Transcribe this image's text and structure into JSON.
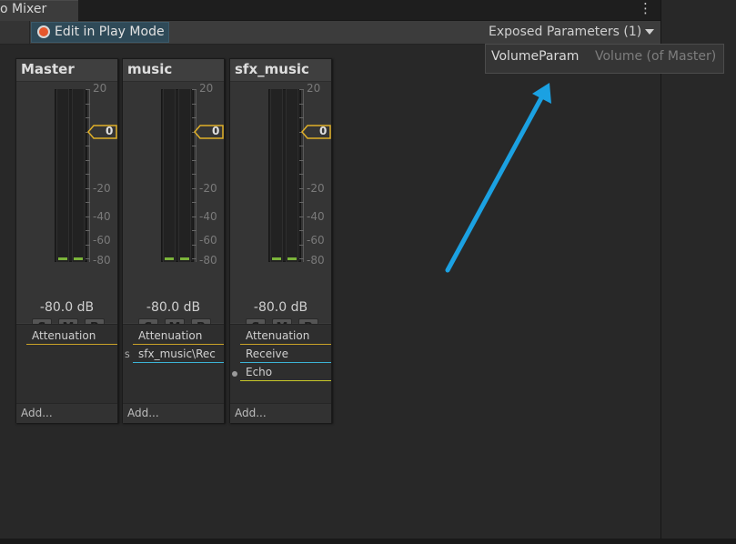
{
  "window": {
    "tab_label": "o Mixer",
    "menu_icon": "kebab-menu-icon"
  },
  "toolbar": {
    "play_mode_label": "Edit in Play Mode",
    "record_icon_color": "#e6572c",
    "exposed_label": "Exposed Parameters (1)"
  },
  "exposed_popup": {
    "param_name": "VolumeParam",
    "param_desc": "Volume (of Master)"
  },
  "annotation": {
    "arrow_color": "#1ba1e2"
  },
  "strips": [
    {
      "title": "Master",
      "db": "-80.0 dB",
      "fader_value": "0",
      "buttons": [
        "S",
        "M",
        "B"
      ],
      "effects": [
        {
          "label": "Attenuation",
          "color": "#c9a227"
        }
      ],
      "add": "Add..."
    },
    {
      "title": "music",
      "db": "-80.0 dB",
      "fader_value": "0",
      "buttons": [
        "S",
        "M",
        "B"
      ],
      "send_marker": "S",
      "effects": [
        {
          "label": "Attenuation",
          "color": "#c9a227"
        },
        {
          "label": "sfx_music\\Rec",
          "color": "#3cb4d6"
        }
      ],
      "add": "Add..."
    },
    {
      "title": "sfx_music",
      "db": "-80.0 dB",
      "fader_value": "0",
      "buttons": [
        "S",
        "M",
        "B"
      ],
      "effects": [
        {
          "label": "Attenuation",
          "color": "#c9a227"
        },
        {
          "label": "Receive",
          "color": "#3cb4d6"
        },
        {
          "label": "Echo",
          "color": "#c9c92a"
        }
      ],
      "add": "Add..."
    }
  ],
  "scale": {
    "labels": [
      "20",
      "-20",
      "-40",
      "-60",
      "-80"
    ]
  },
  "colors": {
    "meter_green": "#7bb33a",
    "fader_outline": "#e0b028"
  }
}
